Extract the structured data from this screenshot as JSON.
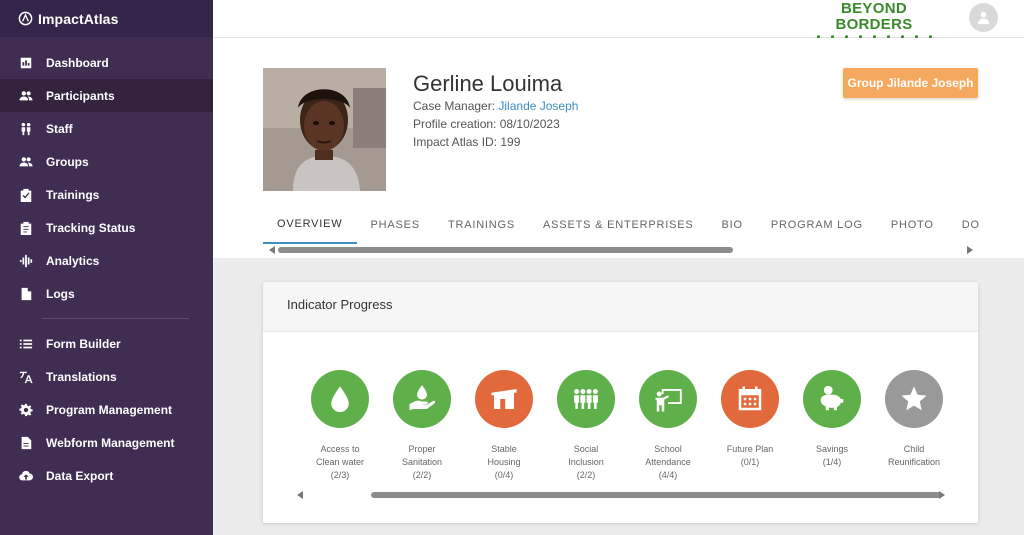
{
  "app": {
    "name": "ImpactAtlas"
  },
  "sidebar": {
    "items": [
      {
        "label": "Dashboard",
        "icon": "chart-icon"
      },
      {
        "label": "Participants",
        "icon": "people-icon"
      },
      {
        "label": "Staff",
        "icon": "staff-icon"
      },
      {
        "label": "Groups",
        "icon": "group-icon"
      },
      {
        "label": "Trainings",
        "icon": "clipboard-check-icon"
      },
      {
        "label": "Tracking Status",
        "icon": "clipboard-list-icon"
      },
      {
        "label": "Analytics",
        "icon": "waveform-icon"
      },
      {
        "label": "Logs",
        "icon": "file-icon"
      }
    ],
    "items2": [
      {
        "label": "Form Builder",
        "icon": "list-icon"
      },
      {
        "label": "Translations",
        "icon": "translate-icon"
      },
      {
        "label": "Program Management",
        "icon": "gear-icon"
      },
      {
        "label": "Webform Management",
        "icon": "file-icon"
      },
      {
        "label": "Data Export",
        "icon": "cloud-upload-icon"
      }
    ]
  },
  "topbar": {
    "logo_text": "BEYOND BORDERS"
  },
  "profile": {
    "name": "Gerline Louima",
    "case_manager_label": "Case Manager:",
    "case_manager": "Jilande Joseph",
    "creation": "Profile creation: 08/10/2023",
    "id_line": "Impact Atlas ID: 199",
    "group_button": "Group Jilande Joseph"
  },
  "tabs": [
    "OVERVIEW",
    "PHASES",
    "TRAININGS",
    "ASSETS & ENTERPRISES",
    "BIO",
    "PROGRAM LOG",
    "PHOTO",
    "DOCUMENTS"
  ],
  "indicators": {
    "title": "Indicator Progress",
    "items": [
      {
        "line1": "Access to",
        "line2": "Clean water",
        "line3": "(2/3)",
        "color": "#5fb04a",
        "icon": "water-drop-icon"
      },
      {
        "line1": "Proper",
        "line2": "Sanitation",
        "line3": "(2/2)",
        "color": "#5fb04a",
        "icon": "hand-water-icon"
      },
      {
        "line1": "Stable",
        "line2": "Housing",
        "line3": "(0/4)",
        "color": "#e2693b",
        "icon": "house-icon"
      },
      {
        "line1": "Social",
        "line2": "Inclusion",
        "line3": "(2/2)",
        "color": "#5fb04a",
        "icon": "people-group-icon"
      },
      {
        "line1": "School",
        "line2": "Attendance",
        "line3": "(4/4)",
        "color": "#5fb04a",
        "icon": "teacher-board-icon"
      },
      {
        "line1": "Future Plan",
        "line2": "(0/1)",
        "line3": "",
        "color": "#e2693b",
        "icon": "calendar-icon"
      },
      {
        "line1": "Savings",
        "line2": "(1/4)",
        "line3": "",
        "color": "#5fb04a",
        "icon": "piggy-bank-icon"
      },
      {
        "line1": "Child",
        "line2": "Reunification",
        "line3": "",
        "color": "#999999",
        "icon": "star-icon"
      }
    ]
  }
}
